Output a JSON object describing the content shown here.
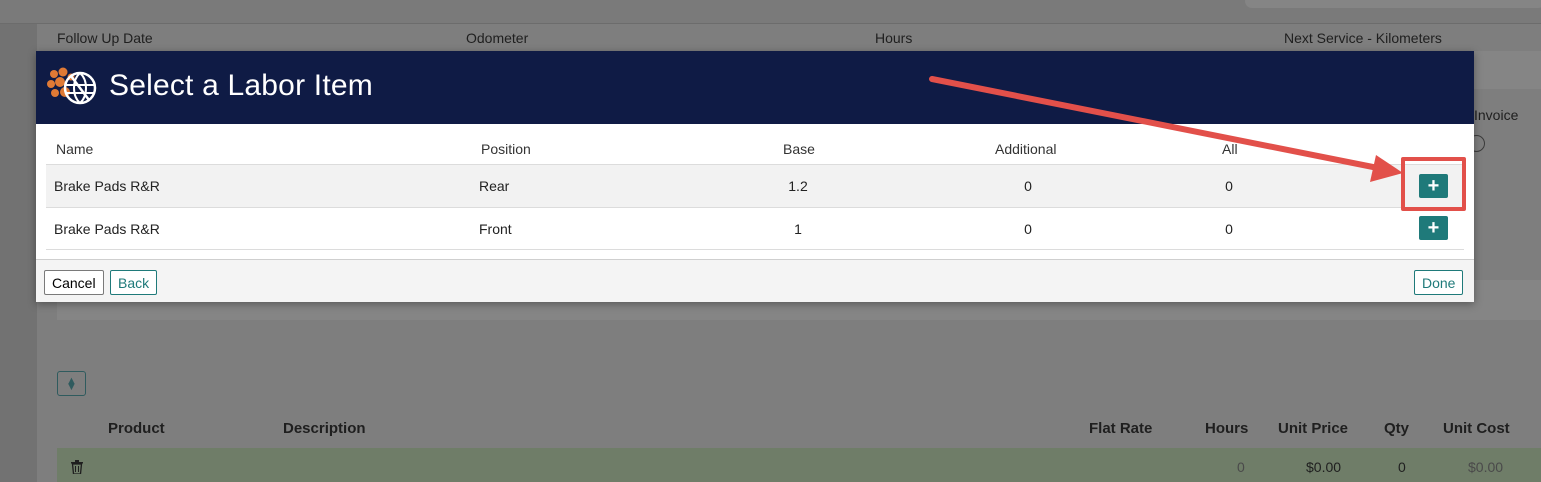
{
  "background": {
    "header_row": {
      "follow_up_date": "Follow Up Date",
      "odometer": "Odometer",
      "hours": "Hours",
      "next_service": "Next Service - Kilometers"
    },
    "invoice_label": "Invoice",
    "table_headers": {
      "product": "Product",
      "description": "Description",
      "flat_rate": "Flat Rate",
      "hours": "Hours",
      "unit_price": "Unit Price",
      "qty": "Qty",
      "unit_cost": "Unit Cost"
    },
    "line_row": {
      "hours": "0",
      "unit_price": "$0.00",
      "qty": "0",
      "unit_cost": "$0.00"
    }
  },
  "modal": {
    "title": "Select a Labor Item",
    "columns": {
      "name": "Name",
      "position": "Position",
      "base": "Base",
      "additional": "Additional",
      "all": "All"
    },
    "rows": [
      {
        "name": "Brake Pads R&R",
        "position": "Rear",
        "base": "1.2",
        "additional": "0",
        "all": "0"
      },
      {
        "name": "Brake Pads R&R",
        "position": "Front",
        "base": "1",
        "additional": "0",
        "all": "0"
      }
    ],
    "add_glyph": "+",
    "footer": {
      "cancel": "Cancel",
      "back": "Back",
      "done": "Done"
    }
  },
  "colors": {
    "header_bg": "#0f1b45",
    "accent_teal": "#1f7a7a",
    "annotation_red": "#e2504a"
  }
}
